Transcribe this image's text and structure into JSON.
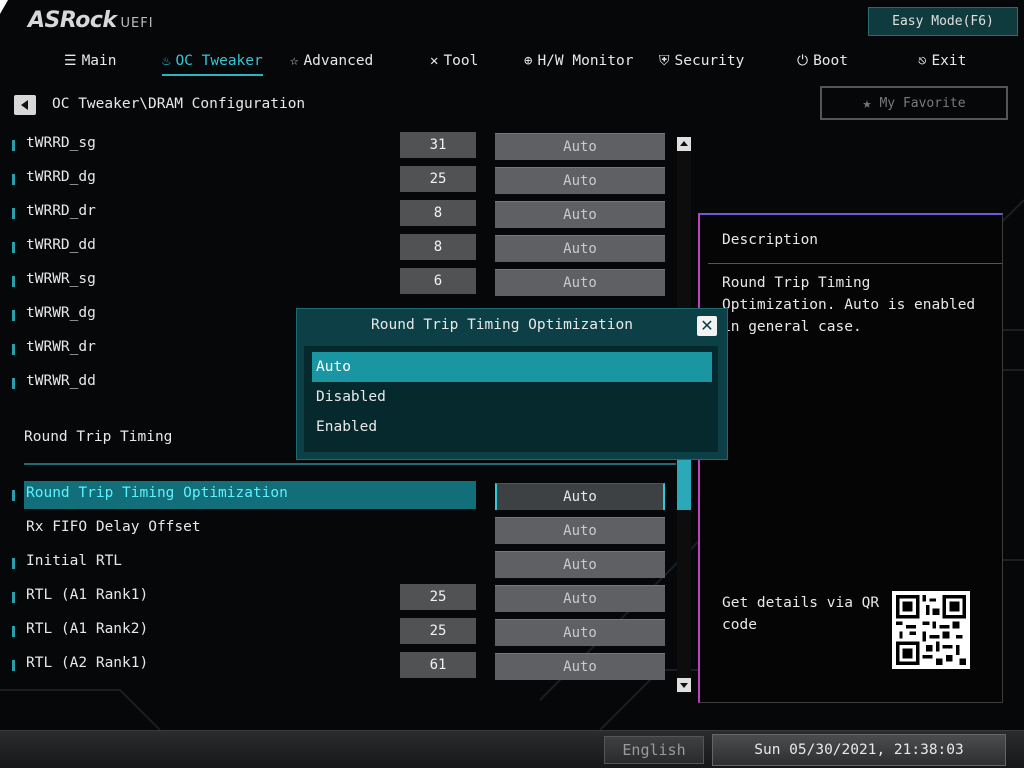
{
  "header": {
    "logo": "ASRock",
    "logo_suffix": "UEFI",
    "easy_mode_label": "Easy Mode(F6)"
  },
  "tabs": [
    {
      "label": "Main",
      "icon": "list-icon"
    },
    {
      "label": "OC Tweaker",
      "icon": "flame-icon",
      "active": true
    },
    {
      "label": "Advanced",
      "icon": "star-outline-icon"
    },
    {
      "label": "Tool",
      "icon": "tools-icon"
    },
    {
      "label": "H/W Monitor",
      "icon": "crosshair-icon"
    },
    {
      "label": "Security",
      "icon": "shield-icon"
    },
    {
      "label": "Boot",
      "icon": "power-icon"
    },
    {
      "label": "Exit",
      "icon": "exit-icon"
    }
  ],
  "breadcrumb": "OC Tweaker\\DRAM Configuration",
  "favorite_label": "My Favorite",
  "settings_upper": [
    {
      "label": "tWRRD_sg",
      "value": "31",
      "option": "Auto"
    },
    {
      "label": "tWRRD_dg",
      "value": "25",
      "option": "Auto"
    },
    {
      "label": "tWRRD_dr",
      "value": "8",
      "option": "Auto"
    },
    {
      "label": "tWRRD_dd",
      "value": "8",
      "option": "Auto"
    },
    {
      "label": "tWRWR_sg",
      "value": "6",
      "option": "Auto"
    },
    {
      "label": "tWRWR_dg",
      "value": "",
      "option": ""
    },
    {
      "label": "tWRWR_dr",
      "value": "",
      "option": ""
    },
    {
      "label": "tWRWR_dd",
      "value": "",
      "option": ""
    }
  ],
  "section_title": "Round Trip Timing",
  "settings_lower": [
    {
      "label": "Round Trip Timing Optimization",
      "value": "",
      "option": "Auto",
      "selected": true
    },
    {
      "label": "Rx FIFO Delay Offset",
      "value": "",
      "option": "Auto"
    },
    {
      "label": "Initial RTL",
      "value": "",
      "option": "Auto"
    },
    {
      "label": "RTL (A1 Rank1)",
      "value": "25",
      "option": "Auto"
    },
    {
      "label": "RTL (A1 Rank2)",
      "value": "25",
      "option": "Auto"
    },
    {
      "label": "RTL (A2 Rank1)",
      "value": "61",
      "option": "Auto"
    }
  ],
  "description": {
    "title": "Description",
    "text": "Round Trip Timing Optimization. Auto is enabled in general case.",
    "qr_text": "Get details via QR code"
  },
  "modal": {
    "title": "Round Trip Timing Optimization",
    "options": [
      "Auto",
      "Disabled",
      "Enabled"
    ],
    "selected": "Auto"
  },
  "footer": {
    "language": "English",
    "datetime": "Sun 05/30/2021, 21:38:03"
  },
  "colors": {
    "accent": "#33c7d6",
    "selection": "#126e78",
    "modal_bg": "#0c4046"
  }
}
